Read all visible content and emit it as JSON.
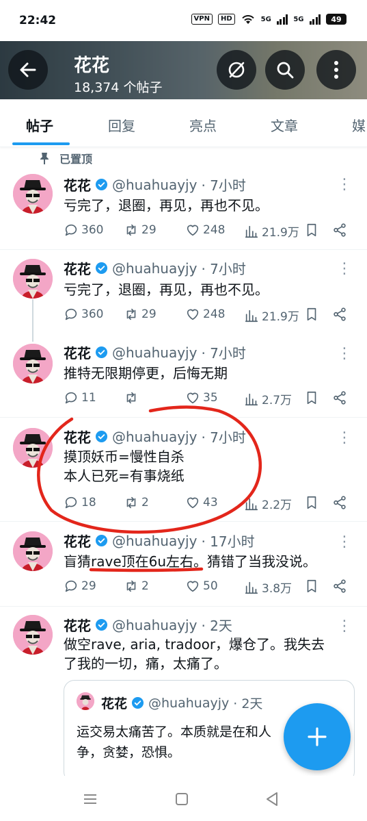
{
  "status_bar": {
    "time": "22:42",
    "vpn": "VPN",
    "hd": "HD",
    "net1": "5G",
    "net2": "5G",
    "battery": "49"
  },
  "header": {
    "title": "花花",
    "subtitle": "18,374 个帖子"
  },
  "tabs": [
    {
      "label": "帖子",
      "active": true
    },
    {
      "label": "回复"
    },
    {
      "label": "亮点"
    },
    {
      "label": "文章"
    },
    {
      "label": "媒"
    }
  ],
  "pinned_label": "已置顶",
  "posts": [
    {
      "name": "花花",
      "handle": "@huahuayjy",
      "time": "· 7小时",
      "lines": [
        "亏完了，退圈，再见，再也不见。"
      ],
      "replies": "360",
      "reposts": "29",
      "likes": "248",
      "views": "21.9万"
    },
    {
      "name": "花花",
      "handle": "@huahuayjy",
      "time": "· 7小时",
      "lines": [
        "亏完了，退圈，再见，再也不见。"
      ],
      "replies": "360",
      "reposts": "29",
      "likes": "248",
      "views": "21.9万"
    },
    {
      "name": "花花",
      "handle": "@huahuayjy",
      "time": "· 7小时",
      "lines": [
        "推特无限期停更，后悔无期"
      ],
      "replies": "11",
      "reposts": "",
      "likes": "35",
      "views": "2.7万"
    },
    {
      "name": "花花",
      "handle": "@huahuayjy",
      "time": "· 7小时",
      "lines": [
        "摸顶妖币=慢性自杀",
        "本人已死=有事烧纸"
      ],
      "replies": "18",
      "reposts": "2",
      "likes": "43",
      "views": "2.2万"
    },
    {
      "name": "花花",
      "handle": "@huahuayjy",
      "time": "· 17小时",
      "lines": [
        "盲猜rave顶在6u左右。猜错了当我没说。"
      ],
      "replies": "29",
      "reposts": "2",
      "likes": "50",
      "views": "3.8万"
    },
    {
      "name": "花花",
      "handle": "@huahuayjy",
      "time": "· 2天",
      "lines": [
        "做空rave, aria, tradoor，爆仓了。我失去",
        "了我的一切，痛，太痛了。"
      ]
    }
  ],
  "quote": {
    "name": "花花",
    "handle": "@huahuayjy",
    "time": "· 2天",
    "lines": [
      "运交易太痛苦了。本质就是在和人",
      "争，贪婪，恐惧。"
    ]
  },
  "colors": {
    "accent": "#1d9bf0",
    "annotation": "#e3261b",
    "text_secondary": "#536471"
  }
}
